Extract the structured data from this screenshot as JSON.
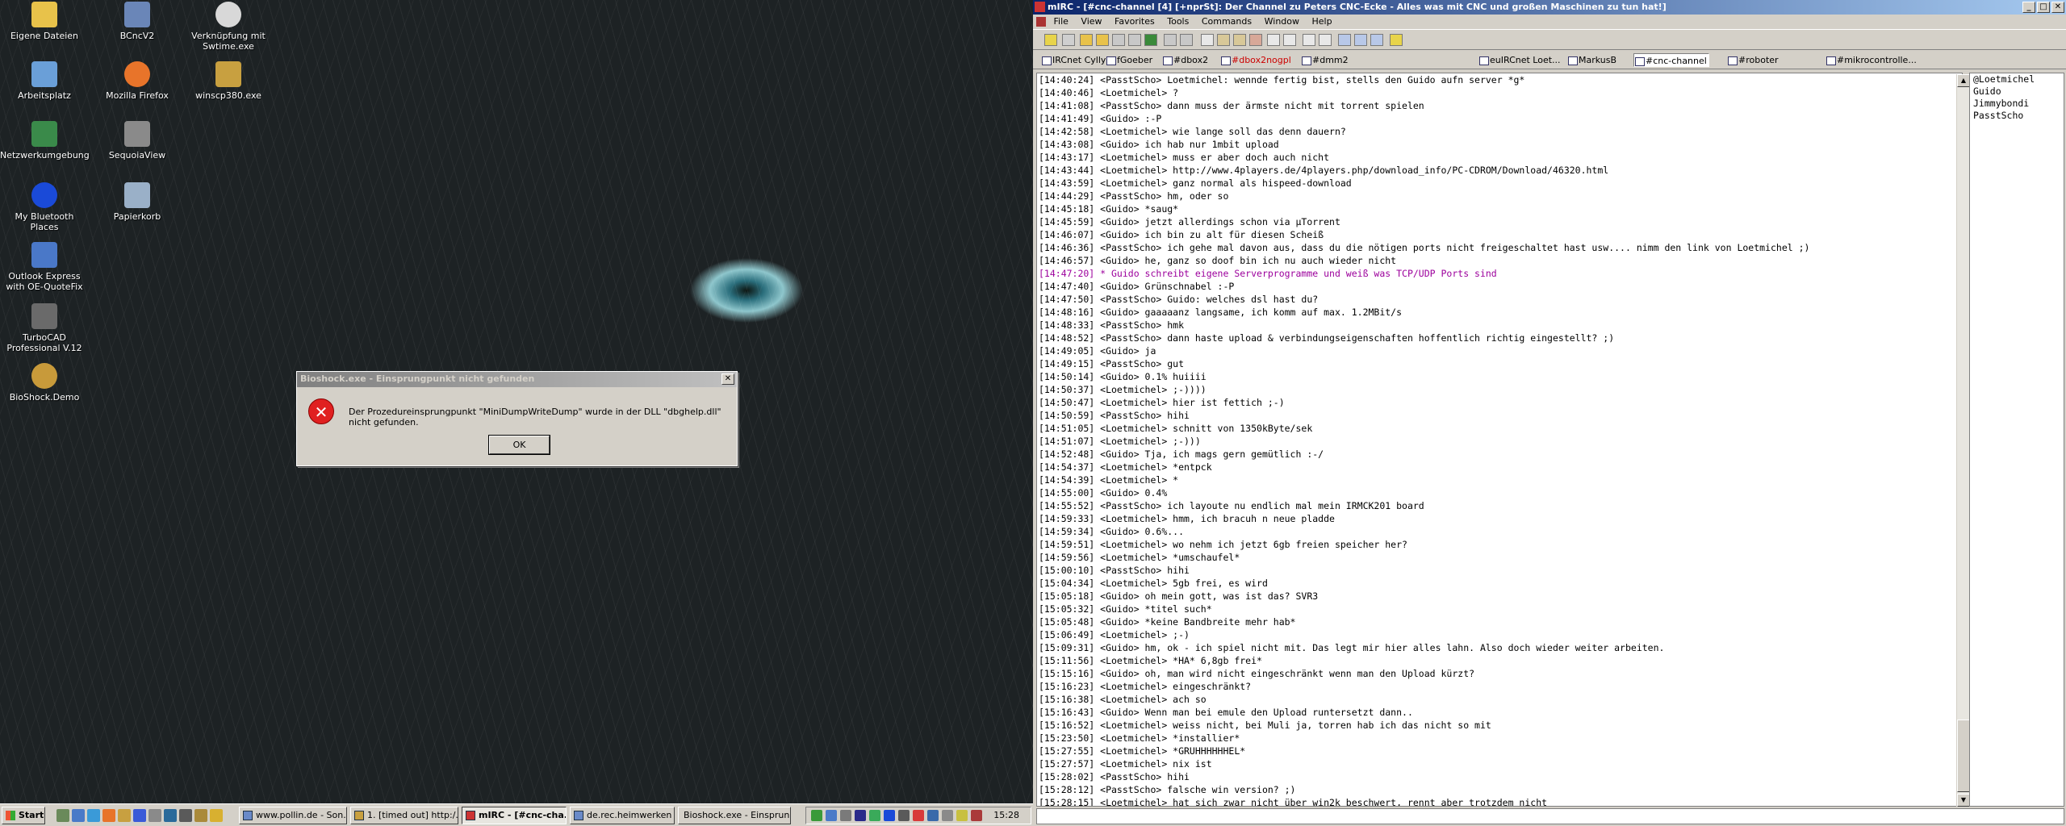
{
  "desktop": {
    "icons": [
      {
        "label": "Eigene Dateien",
        "color": "#e8c24a"
      },
      {
        "label": "BCncV2",
        "color": "#6a86b8"
      },
      {
        "label": "Verknüpfung mit Swtime.exe",
        "color": "#d8d8d8"
      },
      {
        "label": "Arbeitsplatz",
        "color": "#6a9fd8"
      },
      {
        "label": "Mozilla Firefox",
        "color": "#e8742a"
      },
      {
        "label": "winscp380.exe",
        "color": "#c8a040"
      },
      {
        "label": "Netzwerkumgebung",
        "color": "#3a8a4a"
      },
      {
        "label": "SequoiaView",
        "color": "#8a8a8a"
      },
      {
        "label": "My Bluetooth Places",
        "color": "#1a4ad8"
      },
      {
        "label": "Papierkorb",
        "color": "#9ab0c8"
      },
      {
        "label": "Outlook Express with OE-QuoteFix",
        "color": "#4a78c8"
      },
      {
        "label": "TurboCAD Professional V.12",
        "color": "#6a6a6a"
      },
      {
        "label": "BioShock.Demo",
        "color": "#c89a3a"
      }
    ]
  },
  "dialog": {
    "title": "Bioshock.exe - Einsprungpunkt nicht gefunden",
    "message": "Der Prozedureinsprungpunkt \"MiniDumpWriteDump\" wurde in der DLL \"dbghelp.dll\" nicht gefunden.",
    "ok_label": "OK",
    "close_label": "✕",
    "error_glyph": "✕"
  },
  "taskbar": {
    "start_label": "Start",
    "clock": "15:28",
    "buttons": [
      {
        "label": "www.pollin.de - Son..."
      },
      {
        "label": "1. [timed out] http:/..."
      },
      {
        "label": "mIRC - [#cnc-cha..."
      },
      {
        "label": "de.rec.heimwerken ..."
      },
      {
        "label": "Bioshock.exe - Einsprun..."
      }
    ]
  },
  "mirc": {
    "title": "mIRC - [#cnc-channel [4] [+nprSt]: Der Channel zu Peters CNC-Ecke - Alles was mit CNC und großen Maschinen zu tun hat!]",
    "menu": [
      "File",
      "View",
      "Favorites",
      "Tools",
      "Commands",
      "Window",
      "Help"
    ],
    "switchbar": [
      "IRCnet Cylly",
      "fGoeber",
      "#dbox2",
      "#dbox2nogpl",
      "#dmm2",
      "euIRCnet Loet...",
      "MarkusB",
      "#cnc-channel",
      "#roboter",
      "#mikrocontrolle..."
    ],
    "nicklist": [
      "@Loetmichel",
      "Guido",
      "Jimmybondi",
      "PasstScho"
    ],
    "lines": [
      {
        "text": "[14:40:24] <PasstScho> Loetmichel: wennde fertig bist, stells den Guido aufn server *g*"
      },
      {
        "text": "[14:40:46] <Loetmichel> ?"
      },
      {
        "text": "[14:41:08] <PasstScho> dann muss der ärmste nicht mit torrent spielen"
      },
      {
        "text": "[14:41:49] <Guido> :-P"
      },
      {
        "text": "[14:42:58] <Loetmichel> wie lange soll das denn dauern?"
      },
      {
        "text": "[14:43:08] <Guido> ich hab nur 1mbit upload"
      },
      {
        "text": "[14:43:17] <Loetmichel> muss er aber doch auch nicht"
      },
      {
        "text": "[14:43:44] <Loetmichel> http://www.4players.de/4players.php/download_info/PC-CDROM/Download/46320.html"
      },
      {
        "text": "[14:43:59] <Loetmichel> ganz normal als hispeed-download"
      },
      {
        "text": "[14:44:29] <PasstScho> hm, oder so"
      },
      {
        "text": "[14:45:18] <Guido> *saug*"
      },
      {
        "text": "[14:45:59] <Guido> jetzt allerdings schon via µTorrent"
      },
      {
        "text": "[14:46:07] <Guido> ich bin zu alt für diesen Scheiß"
      },
      {
        "text": "[14:46:36] <PasstScho> ich gehe mal davon aus, dass du die nötigen ports nicht freigeschaltet hast usw.... nimm den link von Loetmichel ;)"
      },
      {
        "text": "[14:46:57] <Guido> he, ganz so doof bin ich nu auch wieder nicht"
      },
      {
        "text": "[14:47:20] * Guido schreibt eigene Serverprogramme und weiß was TCP/UDP Ports sind",
        "action": true
      },
      {
        "text": "[14:47:40] <Guido> Grünschnabel :-P"
      },
      {
        "text": "[14:47:50] <PasstScho> Guido: welches dsl hast du?"
      },
      {
        "text": "[14:48:16] <Guido> gaaaaanz langsame, ich komm auf max. 1.2MBit/s"
      },
      {
        "text": "[14:48:33] <PasstScho> hmk"
      },
      {
        "text": "[14:48:52] <PasstScho> dann haste upload & verbindungseigenschaften hoffentlich richtig eingestellt? ;)"
      },
      {
        "text": "[14:49:05] <Guido> ja"
      },
      {
        "text": "[14:49:15] <PasstScho> gut"
      },
      {
        "text": "[14:50:14] <Guido> 0.1% huiiii"
      },
      {
        "text": "[14:50:37] <Loetmichel> ;-))))"
      },
      {
        "text": "[14:50:47] <Loetmichel> hier ist fettich ;-)"
      },
      {
        "text": "[14:50:59] <PasstScho> hihi"
      },
      {
        "text": "[14:51:05] <Loetmichel> schnitt von 1350kByte/sek"
      },
      {
        "text": "[14:51:07] <Loetmichel> ;-)))"
      },
      {
        "text": "[14:52:48] <Guido> Tja, ich mags gern gemütlich :-/"
      },
      {
        "text": "[14:54:37] <Loetmichel> *entpck"
      },
      {
        "text": "[14:54:39] <Loetmichel> *"
      },
      {
        "text": "[14:55:00] <Guido> 0.4%"
      },
      {
        "text": "[14:55:52] <PasstScho> ich layoute nu endlich mal mein IRMCK201 board"
      },
      {
        "text": "[14:59:33] <Loetmichel> hmm, ich bracuh n neue pladde"
      },
      {
        "text": "[14:59:34] <Guido> 0.6%..."
      },
      {
        "text": "[14:59:51] <Loetmichel> wo nehm ich jetzt 6gb freien speicher her?"
      },
      {
        "text": "[14:59:56] <Loetmichel> *umschaufel*"
      },
      {
        "text": "[15:00:10] <PasstScho> hihi"
      },
      {
        "text": "[15:04:34] <Loetmichel> 5gb frei, es wird"
      },
      {
        "text": "[15:05:18] <Guido> oh mein gott, was ist das? SVR3"
      },
      {
        "text": "[15:05:32] <Guido> *titel such*"
      },
      {
        "text": "[15:05:48] <Guido> *keine Bandbreite mehr hab*"
      },
      {
        "text": "[15:06:49] <Loetmichel> ;-)"
      },
      {
        "text": "[15:09:31] <Guido> hm, ok - ich spiel nicht mit. Das legt mir hier alles lahn. Also doch wieder weiter arbeiten."
      },
      {
        "text": "[15:11:56] <Loetmichel> *HA* 6,8gb frei*"
      },
      {
        "text": "[15:15:16] <Guido> oh, man wird nicht eingeschränkt wenn man den Upload kürzt?"
      },
      {
        "text": "[15:16:23] <Loetmichel> eingeschränkt?"
      },
      {
        "text": "[15:16:38] <Loetmichel> ach so"
      },
      {
        "text": "[15:16:43] <Guido> Wenn man bei emule den Upload runtersetzt dann.."
      },
      {
        "text": "[15:16:52] <Loetmichel> weiss nicht, bei Muli ja, torren hab ich das nicht so mit"
      },
      {
        "text": "[15:23:50] <Loetmichel> *installier*"
      },
      {
        "text": "[15:27:55] <Loetmichel> *GRUHHHHHHEL*"
      },
      {
        "text": "[15:27:57] <Loetmichel> nix ist"
      },
      {
        "text": "[15:28:02] <PasstScho> hihi"
      },
      {
        "text": "[15:28:12] <PasstScho> falsche win version? ;)"
      },
      {
        "text": "[15:28:15] <Loetmichel> hat sich zwar nicht über win2k beschwert, rennt aber trotzdem nicht"
      }
    ]
  }
}
